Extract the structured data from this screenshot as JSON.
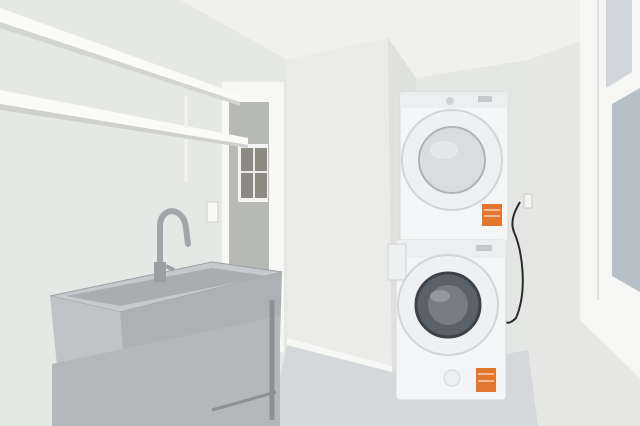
{
  "photo": {
    "washer_label": "",
    "dryer_label": ""
  },
  "colors": {
    "wall": "#e9eae8",
    "wall_shadow": "#d7d9d7",
    "ceiling": "#f1f1ef",
    "floor": "#d6d9db",
    "appliance": "#f4f5f6",
    "steel": "#b9bcbe",
    "steel_dark": "#8e9194",
    "sticker": "#e2762e"
  },
  "icons": [
    "washer",
    "dryer",
    "utility-sink",
    "faucet",
    "window",
    "shelf"
  ]
}
